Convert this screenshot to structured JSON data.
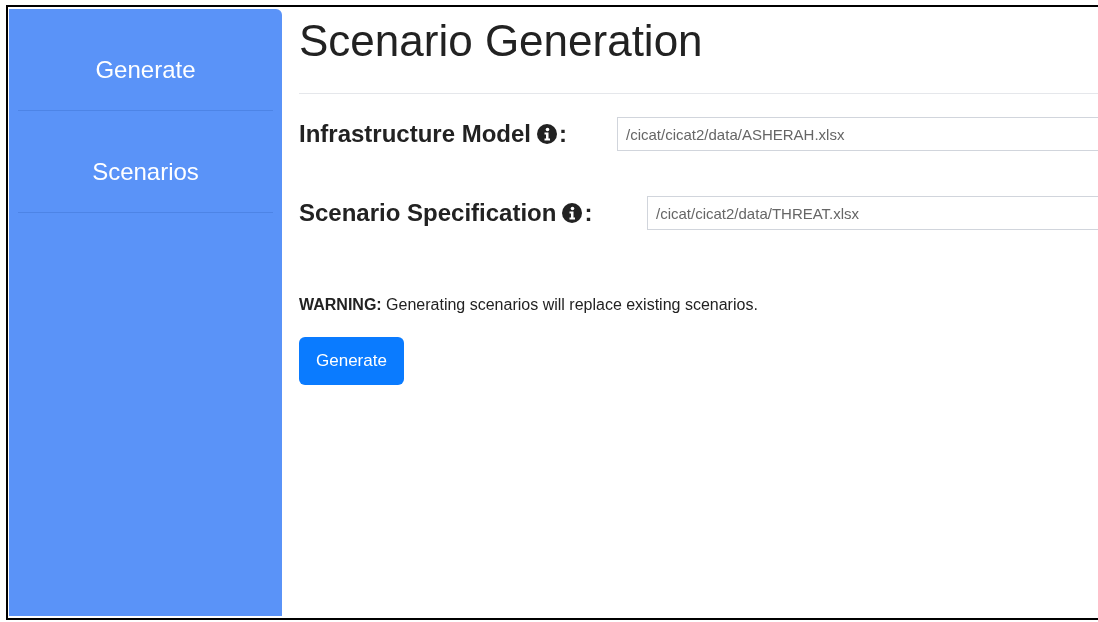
{
  "sidebar": {
    "items": [
      {
        "label": "Generate"
      },
      {
        "label": "Scenarios"
      }
    ]
  },
  "title": "Scenario Generation",
  "fields": [
    {
      "label": "Infrastructure Model",
      "suffix": ":",
      "value": "/cicat/cicat2/data/ASHERAH.xlsx"
    },
    {
      "label": "Scenario Specification",
      "suffix": ":",
      "value": "/cicat/cicat2/data/THREAT.xlsx"
    }
  ],
  "warning": "**WARNING:** Generating scenarios will replace existing scenarios.",
  "button": "Generate"
}
